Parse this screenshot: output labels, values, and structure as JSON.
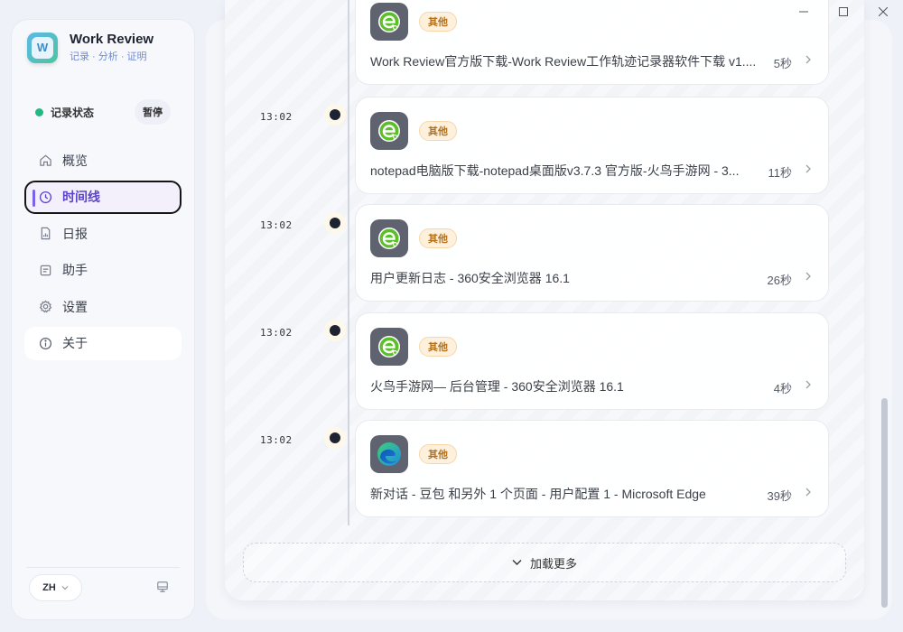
{
  "brand": {
    "title": "Work Review",
    "subtitle": "记录 · 分析 · 证明",
    "logo_letter": "W"
  },
  "status": {
    "label": "记录状态",
    "pause_label": "暂停",
    "dot_color": "#21b882"
  },
  "nav": {
    "items": [
      {
        "label": "概览",
        "icon": "home-icon"
      },
      {
        "label": "时间线",
        "icon": "clock-icon",
        "active": true
      },
      {
        "label": "日报",
        "icon": "report-icon"
      },
      {
        "label": "助手",
        "icon": "assistant-icon"
      },
      {
        "label": "设置",
        "icon": "gear-icon"
      },
      {
        "label": "关于",
        "icon": "info-icon"
      }
    ]
  },
  "language": {
    "current": "ZH"
  },
  "timeline": {
    "entries": [
      {
        "time": "",
        "category": "其他",
        "title": "Work Review官方版下载-Work Review工作轨迹记录器软件下载 v1....",
        "duration": "5秒",
        "app_icon": "360-browser-icon"
      },
      {
        "time": "13:02",
        "category": "其他",
        "title": "notepad电脑版下载-notepad桌面版v3.7.3 官方版-火鸟手游网 - 3...",
        "duration": "11秒",
        "app_icon": "360-browser-icon"
      },
      {
        "time": "13:02",
        "category": "其他",
        "title": "用户更新日志 - 360安全浏览器 16.1",
        "duration": "26秒",
        "app_icon": "360-browser-icon"
      },
      {
        "time": "13:02",
        "category": "其他",
        "title": "火鸟手游网— 后台管理 - 360安全浏览器 16.1",
        "duration": "4秒",
        "app_icon": "360-browser-icon"
      },
      {
        "time": "13:02",
        "category": "其他",
        "title": "新对话 - 豆包 和另外 1 个页面 - 用户配置 1 - Microsoft Edge",
        "duration": "39秒",
        "app_icon": "edge-browser-icon"
      }
    ],
    "load_more_label": "加载更多"
  },
  "colors": {
    "accent": "#5a45c9",
    "badge_bg": "#fdf1de",
    "badge_text": "#b5701c"
  }
}
